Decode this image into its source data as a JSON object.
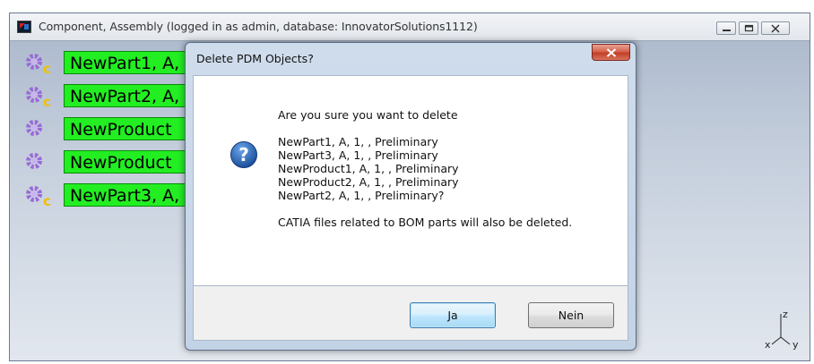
{
  "app": {
    "title": "Component, Assembly (logged in as admin, database: InnovatorSolutions1112)"
  },
  "tree": {
    "items": [
      {
        "label": "NewPart1, A,",
        "icon": "part-gear-icon"
      },
      {
        "label": "NewPart2, A,",
        "icon": "part-gear-icon"
      },
      {
        "label": "NewProduct",
        "icon": "product-gear-icon"
      },
      {
        "label": "NewProduct",
        "icon": "product-gear-icon"
      },
      {
        "label": "NewPart3, A,",
        "icon": "part-gear-icon"
      }
    ]
  },
  "axis": {
    "z": "z",
    "x": "x",
    "y": "y"
  },
  "dialog": {
    "title": "Delete PDM Objects?",
    "message": {
      "question": "Are you sure you want to delete",
      "items": [
        "NewPart1, A, 1, , Preliminary",
        "NewPart3, A, 1, , Preliminary",
        "NewProduct1, A, 1, , Preliminary",
        "NewProduct2, A, 1, , Preliminary",
        "NewPart2, A, 1, , Preliminary?"
      ],
      "note": "CATIA files related to BOM parts will also be deleted."
    },
    "buttons": {
      "yes": "Ja",
      "no": "Nein"
    }
  },
  "colors": {
    "tree_label_bg": "#22ee22",
    "gear": "#9a6ad8",
    "part_badge": "#f0c000"
  }
}
